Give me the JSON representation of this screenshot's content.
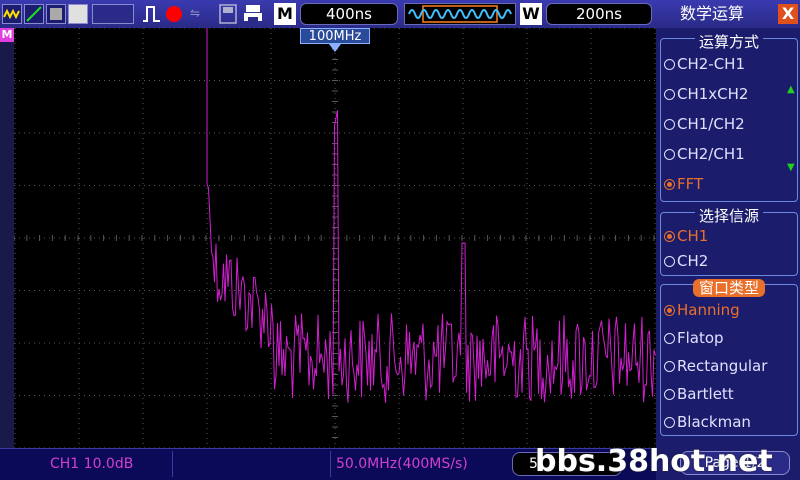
{
  "toolbar": {
    "timebase": "400ns",
    "window_timebase": "200ns",
    "m_label": "M",
    "w_label": "W"
  },
  "marker": {
    "freq_label": "100MHz",
    "math_tag": "M"
  },
  "status": {
    "channel_scale": "CH1 10.0dB",
    "freq_rate": "50.0MHz(400MS/s)",
    "rate_box": "5"
  },
  "panel": {
    "title": "数学运算",
    "close": "X",
    "operation_group": "运算方式",
    "operations": [
      {
        "label": "CH2-CH1",
        "selected": false
      },
      {
        "label": "CH1xCH2",
        "selected": false
      },
      {
        "label": "CH1/CH2",
        "selected": false
      },
      {
        "label": "CH2/CH1",
        "selected": false
      },
      {
        "label": "FFT",
        "selected": true
      }
    ],
    "source_group": "选择信源",
    "sources": [
      {
        "label": "CH1",
        "selected": true
      },
      {
        "label": "CH2",
        "selected": false
      }
    ],
    "window_group": "窗口类型",
    "windows": [
      {
        "label": "Hanning",
        "selected": true
      },
      {
        "label": "Flatop",
        "selected": false
      },
      {
        "label": "Rectangular",
        "selected": false
      },
      {
        "label": "Bartlett",
        "selected": false
      },
      {
        "label": "Blackman",
        "selected": false
      }
    ],
    "page": "Page 1/2"
  },
  "watermark": "bbs.38hot.net",
  "colors": {
    "trace": "#d020d0",
    "grid": "#5a5a5a",
    "selected_option": "#e8702a",
    "accent": "#2a2a88"
  }
}
